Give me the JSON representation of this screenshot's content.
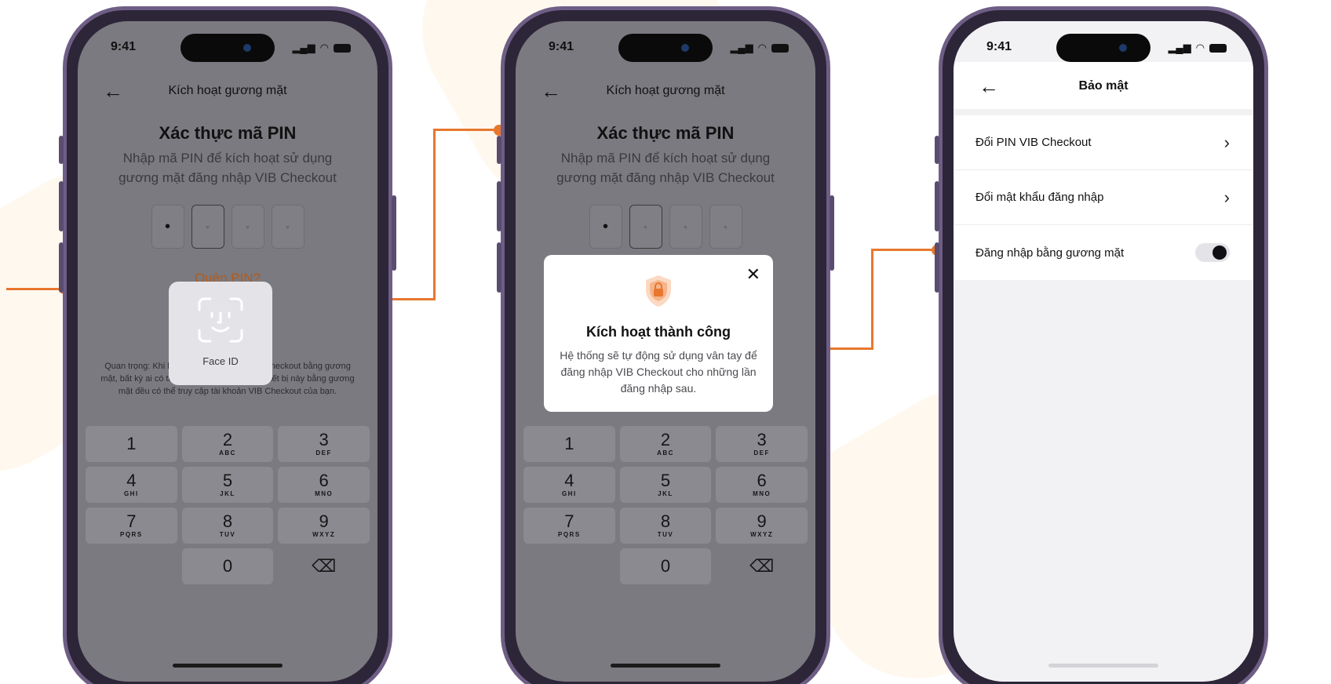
{
  "status": {
    "time": "9:41"
  },
  "screen1": {
    "nav_title": "Kích hoạt gương mặt",
    "pin_title": "Xác thực mã PIN",
    "pin_subtitle": "Nhập mã PIN để kích hoạt sử dụng gương mặt đăng nhập VIB Checkout",
    "pin_entered": "•",
    "pin_empty": "•",
    "forgot_pin": "Quên PIN?",
    "note": "Quan trọng: Khi kích hoạt đăng nhập VIB Checkout bằng gương mặt, bất kỳ ai có thể đăng nhập được vào thiết bị này bằng gương mặt đều có thể truy cập tài khoản VIB Checkout của bạn.",
    "faceid_label": "Face ID"
  },
  "screen2": {
    "nav_title": "Kích hoạt gương mặt",
    "pin_title": "Xác thực mã PIN",
    "pin_subtitle": "Nhập mã PIN để kích hoạt sử dụng gương mặt đăng nhập VIB Checkout",
    "modal": {
      "close": "✕",
      "title": "Kích hoạt thành công",
      "body": "Hệ thống sẽ tự động sử dụng vân tay để đăng nhập VIB Checkout cho những lần đăng nhập sau."
    }
  },
  "keypad": [
    {
      "digit": "1",
      "letters": ""
    },
    {
      "digit": "2",
      "letters": "ABC"
    },
    {
      "digit": "3",
      "letters": "DEF"
    },
    {
      "digit": "4",
      "letters": "GHI"
    },
    {
      "digit": "5",
      "letters": "JKL"
    },
    {
      "digit": "6",
      "letters": "MNO"
    },
    {
      "digit": "7",
      "letters": "PQRS"
    },
    {
      "digit": "8",
      "letters": "TUV"
    },
    {
      "digit": "9",
      "letters": "WXYZ"
    },
    {
      "digit": "0",
      "letters": ""
    }
  ],
  "backspace_glyph": "⌫",
  "screen3": {
    "nav_title": "Bảo mật",
    "rows": [
      {
        "label": "Đổi PIN VIB Checkout"
      },
      {
        "label": "Đổi mật khẩu đăng nhập"
      },
      {
        "label": "Đăng nhập bằng gương mặt"
      }
    ],
    "face_login_enabled": true
  },
  "icons": {
    "back": "arrow-left-icon",
    "chevron": "chevron-right-icon",
    "faceid": "face-id-icon",
    "shield": "shield-lock-icon",
    "close": "close-icon"
  },
  "colors": {
    "accent": "#e8772e",
    "link": "#b45a1a",
    "frame": "#6e5e85"
  }
}
